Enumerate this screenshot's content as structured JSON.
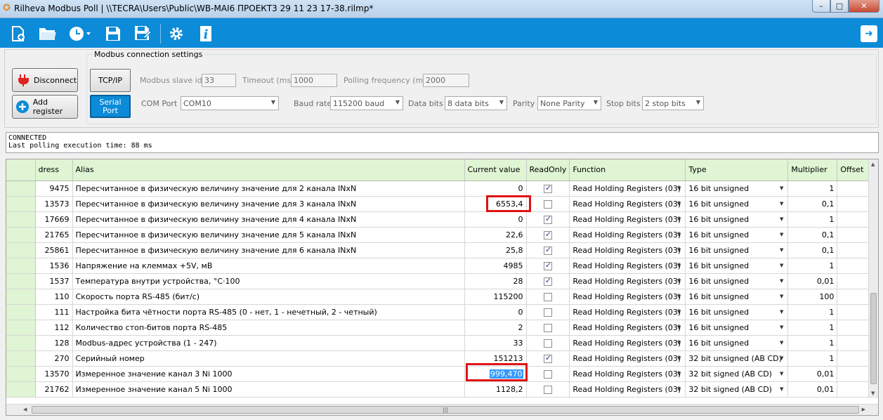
{
  "window": {
    "title": "Rilheva Modbus Poll | \\\\TECRA\\Users\\Public\\WB-MAI6 ПРОЕКТ3 29 11 23 17-38.rilmp*",
    "min_glyph": "–",
    "max_glyph": "□",
    "close_glyph": "✕"
  },
  "toolbar": {
    "icons": [
      "new-file-icon",
      "open-folder-icon",
      "clock-icon",
      "save-icon",
      "save-as-icon",
      "gear-icon",
      "info-icon",
      "exit-icon"
    ],
    "exit_glyph": "➜"
  },
  "panel": {
    "disconnect_label": "Disconnect",
    "add_register_label": "Add register",
    "group_title": "Modbus connection settings",
    "tcp_label": "TCP/IP",
    "serial_label": "Serial Port",
    "slave_id": {
      "label": "Modbus slave id",
      "value": "33"
    },
    "timeout": {
      "label": "Timeout (ms)",
      "value": "1000"
    },
    "polling": {
      "label": "Polling frequency (ms)",
      "value": "2000"
    },
    "com_port": {
      "label": "COM Port",
      "value": "COM10"
    },
    "baud_rate": {
      "label": "Baud rate",
      "value": "115200 baud"
    },
    "data_bits": {
      "label": "Data bits",
      "value": "8 data bits"
    },
    "parity": {
      "label": "Parity",
      "value": "None Parity"
    },
    "stop_bits": {
      "label": "Stop bits",
      "value": "2 stop bits"
    }
  },
  "status": {
    "line1": "CONNECTED",
    "line2": "Last polling execution time: 88 ms"
  },
  "grid": {
    "columns": {
      "address": "dress",
      "alias": "Alias",
      "current_value": "Current value",
      "readonly": "ReadOnly",
      "function": "Function",
      "type": "Type",
      "multiplier": "Multiplier",
      "offset": "Offset"
    },
    "rows": [
      {
        "address": "9475",
        "alias": "Пересчитанное в физическую величину значение для 2 канала INxN",
        "value": "0",
        "readonly": true,
        "function": "Read Holding Registers (03)",
        "type": "16 bit unsigned",
        "multiplier": "1",
        "offset": ""
      },
      {
        "address": "13573",
        "alias": "Пересчитанное в физическую величину значение для 3 канала INxN",
        "value": "6553,4",
        "readonly": false,
        "function": "Read Holding Registers (03)",
        "type": "16 bit unsigned",
        "multiplier": "0,1",
        "offset": ""
      },
      {
        "address": "17669",
        "alias": "Пересчитанное в физическую величину значение для 4 канала INxN",
        "value": "0",
        "readonly": true,
        "function": "Read Holding Registers (03)",
        "type": "16 bit unsigned",
        "multiplier": "1",
        "offset": ""
      },
      {
        "address": "21765",
        "alias": "Пересчитанное в физическую величину значение для 5 канала INxN",
        "value": "22,6",
        "readonly": true,
        "function": "Read Holding Registers (03)",
        "type": "16 bit unsigned",
        "multiplier": "0,1",
        "offset": ""
      },
      {
        "address": "25861",
        "alias": "Пересчитанное в физическую величину значение для 6 канала INxN",
        "value": "25,8",
        "readonly": true,
        "function": "Read Holding Registers (03)",
        "type": "16 bit unsigned",
        "multiplier": "0,1",
        "offset": ""
      },
      {
        "address": "1536",
        "alias": "Напряжение на клеммах +5V, мВ",
        "value": "4985",
        "readonly": true,
        "function": "Read Holding Registers (03)",
        "type": "16 bit unsigned",
        "multiplier": "1",
        "offset": ""
      },
      {
        "address": "1537",
        "alias": "Температура внутри устройства, °С·100",
        "value": "28",
        "readonly": true,
        "function": "Read Holding Registers (03)",
        "type": "16 bit unsigned",
        "multiplier": "0,01",
        "offset": ""
      },
      {
        "address": "110",
        "alias": "Скорость порта RS-485 (бит/с)",
        "value": "115200",
        "readonly": false,
        "function": "Read Holding Registers (03)",
        "type": "16 bit unsigned",
        "multiplier": "100",
        "offset": ""
      },
      {
        "address": "111",
        "alias": "Настройка бита чётности порта RS-485 (0 - нет, 1 - нечетный, 2 - четный)",
        "value": "0",
        "readonly": false,
        "function": "Read Holding Registers (03)",
        "type": "16 bit unsigned",
        "multiplier": "1",
        "offset": ""
      },
      {
        "address": "112",
        "alias": "Количество стоп-битов порта RS-485",
        "value": "2",
        "readonly": false,
        "function": "Read Holding Registers (03)",
        "type": "16 bit unsigned",
        "multiplier": "1",
        "offset": ""
      },
      {
        "address": "128",
        "alias": "Modbus-адрес устройства (1 - 247)",
        "value": "33",
        "readonly": false,
        "function": "Read Holding Registers (03)",
        "type": "16 bit unsigned",
        "multiplier": "1",
        "offset": ""
      },
      {
        "address": "270",
        "alias": "Серийный номер",
        "value": "151213",
        "readonly": true,
        "function": "Read Holding Registers (03)",
        "type": "32 bit unsigned (AB CD)",
        "multiplier": "1",
        "offset": ""
      },
      {
        "address": "13570",
        "alias": "Измеренное значение канал 3 Ni 1000",
        "value": "999,470",
        "readonly": false,
        "function": "Read Holding Registers (03)",
        "type": "32 bit signed (AB CD)",
        "multiplier": "0,01",
        "offset": ""
      },
      {
        "address": "21762",
        "alias": "Измеренное значение канал 5 Ni 1000",
        "value": "1128,2",
        "readonly": false,
        "function": "Read Holding Registers (03)",
        "type": "32 bit signed (AB CD)",
        "multiplier": "0,01",
        "offset": ""
      }
    ],
    "selected_value_row": 12,
    "scroll_grip": "|||"
  },
  "colors": {
    "accent": "#0b8bd8",
    "header_green": "#dff5d3",
    "highlight_red": "#e01313",
    "selection_blue": "#3399ff"
  }
}
